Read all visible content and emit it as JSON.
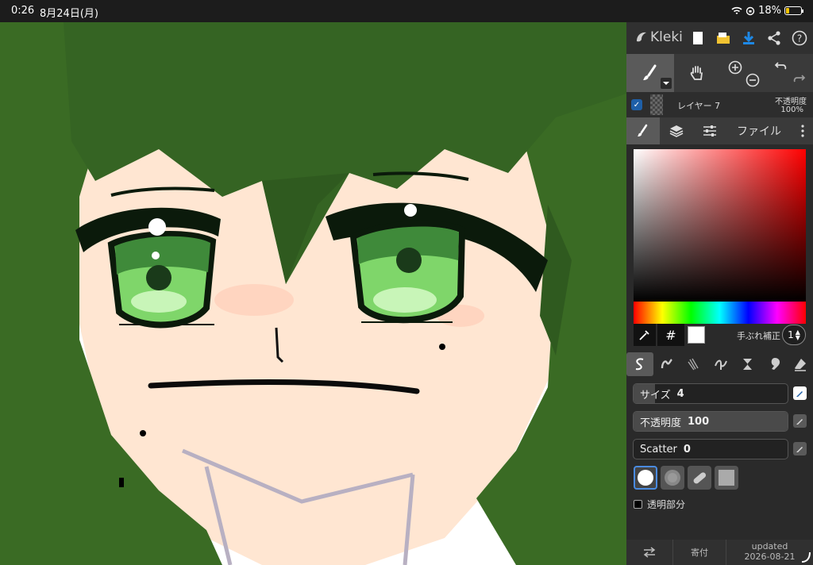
{
  "status": {
    "time": "0:26",
    "date": "8月24日(月)",
    "battery": "18%"
  },
  "topbar": {
    "app_name": "Kleki",
    "icons": [
      "new-file-icon",
      "open-folder-icon",
      "download-icon",
      "share-icon",
      "help-icon"
    ]
  },
  "layer": {
    "name": "レイヤー 7",
    "opacity_label": "不透明度",
    "opacity_value": "100%"
  },
  "tabs": {
    "file_label": "ファイル"
  },
  "color": {
    "hash": "#",
    "stabilizer_label": "手ぶれ補正",
    "stabilizer_value": "1"
  },
  "brush_settings": {
    "size_label": "サイズ",
    "size_value": "4",
    "opacity_label": "不透明度",
    "opacity_value": "100",
    "scatter_label": "Scatter",
    "scatter_value": "0",
    "transparent_label": "透明部分"
  },
  "bottom": {
    "donate": "寄付",
    "updated_label": "updated",
    "updated_date": "2026-08-21"
  },
  "colors": {
    "accent": "#1e88e5",
    "hair": "#3a6b24",
    "skin": "#ffe6d2",
    "eye": "#7fd66a"
  }
}
